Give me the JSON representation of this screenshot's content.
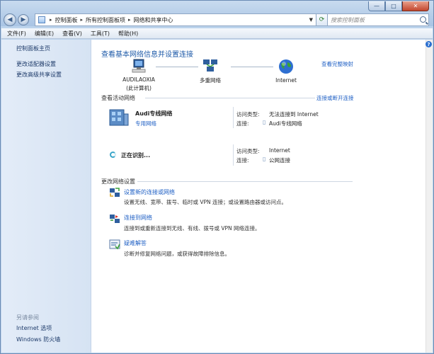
{
  "window": {
    "controls": {
      "minimize": "—",
      "maximize": "□",
      "close": "✕"
    }
  },
  "address": {
    "crumbs": [
      "控制面板",
      "所有控制面板项",
      "网络和共享中心"
    ],
    "search_placeholder": "搜索控制面板"
  },
  "menu": [
    "文件(F)",
    "编辑(E)",
    "查看(V)",
    "工具(T)",
    "帮助(H)"
  ],
  "sidebar": {
    "items": [
      "控制面板主页",
      "更改适配器设置",
      "更改高级共享设置"
    ],
    "see_also_label": "另请参阅",
    "see_also": [
      "Internet 选项",
      "Windows 防火墙"
    ]
  },
  "main": {
    "title": "查看基本网络信息并设置连接",
    "full_map": "查看完整映射",
    "nodes": [
      {
        "name": "AUDILAOXIA",
        "sub": "(此计算机)"
      },
      {
        "name": "多重网络",
        "sub": ""
      },
      {
        "name": "Internet",
        "sub": ""
      }
    ],
    "active_header": "查看活动网络",
    "connect_link": "连接或断开连接",
    "networks": [
      {
        "name": "Audi专线网络",
        "type_link": "专用网络",
        "access_label": "访问类型:",
        "access_value": "无法连接到 Internet",
        "conn_label": "连接:",
        "conn_value": "Audi专线网络"
      },
      {
        "name": "正在识别...",
        "type_link": "",
        "access_label": "访问类型:",
        "access_value": "Internet",
        "conn_label": "连接:",
        "conn_value": "公网连接"
      }
    ],
    "change_header": "更改网络设置",
    "tasks": [
      {
        "title": "设置新的连接或网络",
        "desc": "设置无线、宽带、拨号、临时或 VPN 连接；或设置路由器或访问点。"
      },
      {
        "title": "连接到网络",
        "desc": "连接到或重新连接到无线、有线、拨号或 VPN 网络连接。"
      },
      {
        "title": "疑难解答",
        "desc": "诊断并修复网络问题，或获得故障排除信息。"
      }
    ]
  }
}
